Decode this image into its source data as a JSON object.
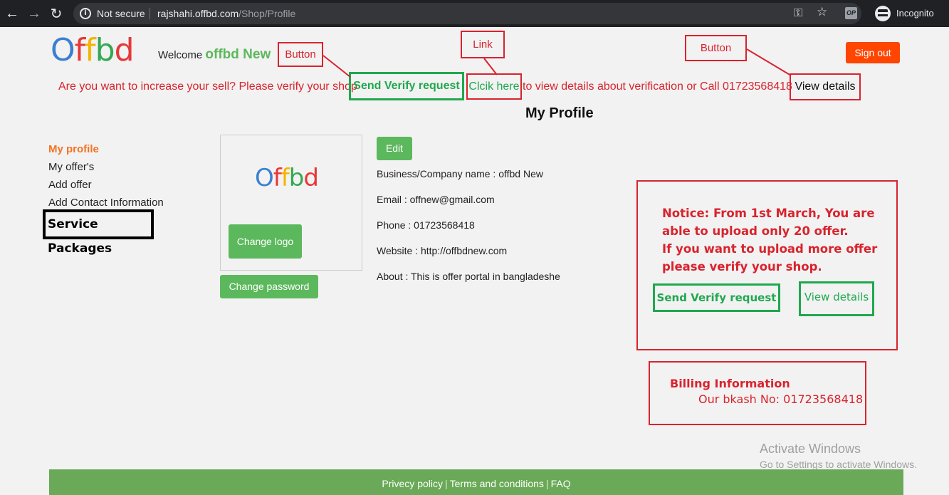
{
  "browser": {
    "security_label": "Not secure",
    "url_host": "rajshahi.offbd.com",
    "url_path": "/Shop/Profile",
    "profile_label": "Incognito",
    "extension_label": "OP"
  },
  "header": {
    "logo_letters": [
      "O",
      "f",
      "f",
      "b",
      "d"
    ],
    "welcome_prefix": "Welcome",
    "shop_name": "offbd New",
    "signout_label": "Sign out"
  },
  "verify_banner": {
    "prompt": "Are you want to increase your sell? Please verify your shop",
    "verify_button": "Send Verify request",
    "link_text": "Clcik here",
    "after_link": "to view details about verification or Call 01723568418",
    "view_details_button": "View details"
  },
  "annotations": {
    "button_1": "Button",
    "link": "Link",
    "button_2": "Button"
  },
  "page_title": "My Profile",
  "sidebar": {
    "items": [
      {
        "label": "My profile",
        "active": true
      },
      {
        "label": "My offer's"
      },
      {
        "label": "Add offer"
      },
      {
        "label": "Add Contact Information"
      }
    ],
    "service_packages": "Service Packages"
  },
  "profile": {
    "change_logo": "Change logo",
    "change_password": "Change password",
    "edit": "Edit",
    "business": "Business/Company name : offbd New",
    "email": "Email : offnew@gmail.com",
    "phone": "Phone : 01723568418",
    "website": "Website : http://offbdnew.com",
    "about": "About : This is offer portal in bangladeshe"
  },
  "notice": {
    "text_line1": "Notice: From 1st March, You are",
    "text_line2": "able to upload only 20 offer.",
    "text_line3": "If you want to upload more offer",
    "text_line4": "please verify your shop.",
    "send_verify": "Send Verify request",
    "view_details": "View details"
  },
  "billing": {
    "title": "Billing Information",
    "bkash": "Our bkash No: 01723568418"
  },
  "watermark": {
    "title": "Activate Windows",
    "subtitle": "Go to Settings to activate Windows."
  },
  "footer": {
    "links": [
      "Privecy policy",
      "Terms and conditions",
      "FAQ"
    ]
  },
  "colors": {
    "accent_green": "#5cb85c",
    "signout_orange": "#ff4500",
    "annotation_red": "#d9232d",
    "footer_green": "#6aa957"
  }
}
